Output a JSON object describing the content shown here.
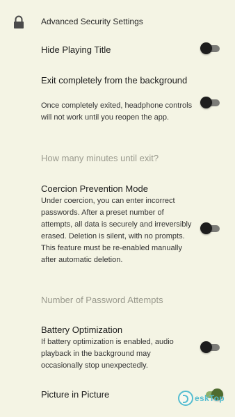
{
  "header": {
    "icon": "lock-icon",
    "title": "Advanced Security Settings"
  },
  "settings": {
    "hide_playing_title": {
      "title": "Hide Playing Title",
      "enabled": false
    },
    "exit_background": {
      "title": "Exit completely from the background",
      "description": "Once completely exited, headphone controls will not work until you reopen the app.",
      "enabled": false
    },
    "minutes_until_exit": {
      "title": "How many minutes until exit?"
    },
    "coercion_prevention": {
      "title": "Coercion Prevention Mode",
      "description": "Under coercion, you can enter incorrect passwords. After a preset number of attempts, all data is securely and irreversibly erased. Deletion is silent, with no prompts. This feature must be re-enabled manually after automatic deletion.",
      "enabled": false
    },
    "password_attempts": {
      "title": "Number of Password Attempts"
    },
    "battery_optimization": {
      "title": "Battery Optimization",
      "description": "If battery optimization is enabled, audio playback in the background may occasionally stop unexpectedly.",
      "enabled": false
    },
    "picture_in_picture": {
      "title": "Picture in Picture",
      "enabled": true
    }
  },
  "watermark": {
    "text": "eskTop"
  },
  "colors": {
    "background": "#f4f4e4",
    "toggle_off_thumb": "#1d1d1d",
    "toggle_off_track": "#7c7c78",
    "toggle_on_thumb": "#4e6b2e",
    "toggle_on_track": "#8fb06a",
    "muted_text": "#9a9a8e"
  }
}
